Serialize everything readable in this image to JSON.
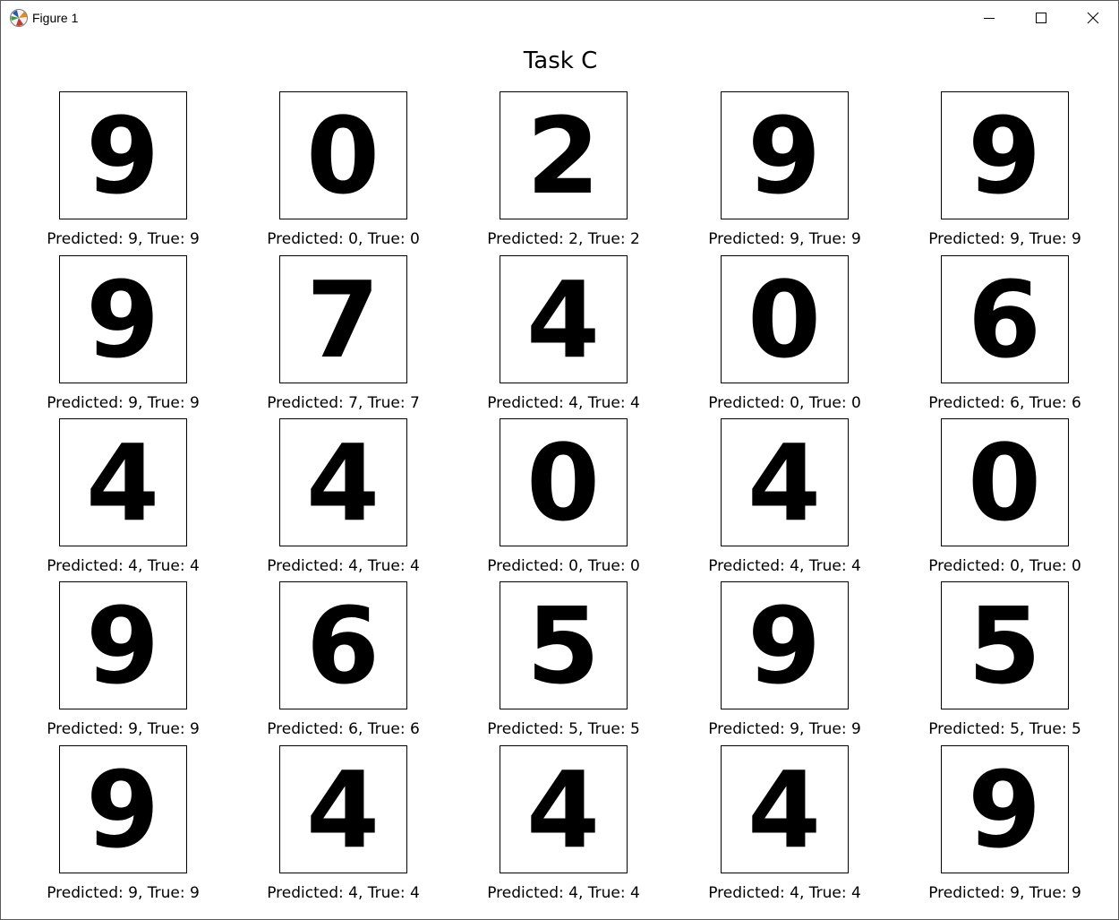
{
  "window": {
    "title": "Figure 1",
    "icon": "matplotlib-icon",
    "controls": [
      "minimize-icon",
      "maximize-icon",
      "close-icon"
    ]
  },
  "figure": {
    "title": "Task C",
    "panels": [
      {
        "digit": "9",
        "caption": "Predicted: 9, True: 9"
      },
      {
        "digit": "0",
        "caption": "Predicted: 0, True: 0"
      },
      {
        "digit": "2",
        "caption": "Predicted: 2, True: 2"
      },
      {
        "digit": "9",
        "caption": "Predicted: 9, True: 9"
      },
      {
        "digit": "9",
        "caption": "Predicted: 9, True: 9"
      },
      {
        "digit": "9",
        "caption": "Predicted: 9, True: 9"
      },
      {
        "digit": "7",
        "caption": "Predicted: 7, True: 7"
      },
      {
        "digit": "4",
        "caption": "Predicted: 4, True: 4"
      },
      {
        "digit": "0",
        "caption": "Predicted: 0, True: 0"
      },
      {
        "digit": "6",
        "caption": "Predicted: 6, True: 6"
      },
      {
        "digit": "4",
        "caption": "Predicted: 4, True: 4"
      },
      {
        "digit": "4",
        "caption": "Predicted: 4, True: 4"
      },
      {
        "digit": "0",
        "caption": "Predicted: 0, True: 0"
      },
      {
        "digit": "4",
        "caption": "Predicted: 4, True: 4"
      },
      {
        "digit": "0",
        "caption": "Predicted: 0, True: 0"
      },
      {
        "digit": "9",
        "caption": "Predicted: 9, True: 9"
      },
      {
        "digit": "6",
        "caption": "Predicted: 6, True: 6"
      },
      {
        "digit": "5",
        "caption": "Predicted: 5, True: 5"
      },
      {
        "digit": "9",
        "caption": "Predicted: 9, True: 9"
      },
      {
        "digit": "5",
        "caption": "Predicted: 5, True: 5"
      },
      {
        "digit": "9",
        "caption": "Predicted: 9, True: 9"
      },
      {
        "digit": "4",
        "caption": "Predicted: 4, True: 4"
      },
      {
        "digit": "4",
        "caption": "Predicted: 4, True: 4"
      },
      {
        "digit": "4",
        "caption": "Predicted: 4, True: 4"
      },
      {
        "digit": "9",
        "caption": "Predicted: 9, True: 9"
      }
    ]
  }
}
